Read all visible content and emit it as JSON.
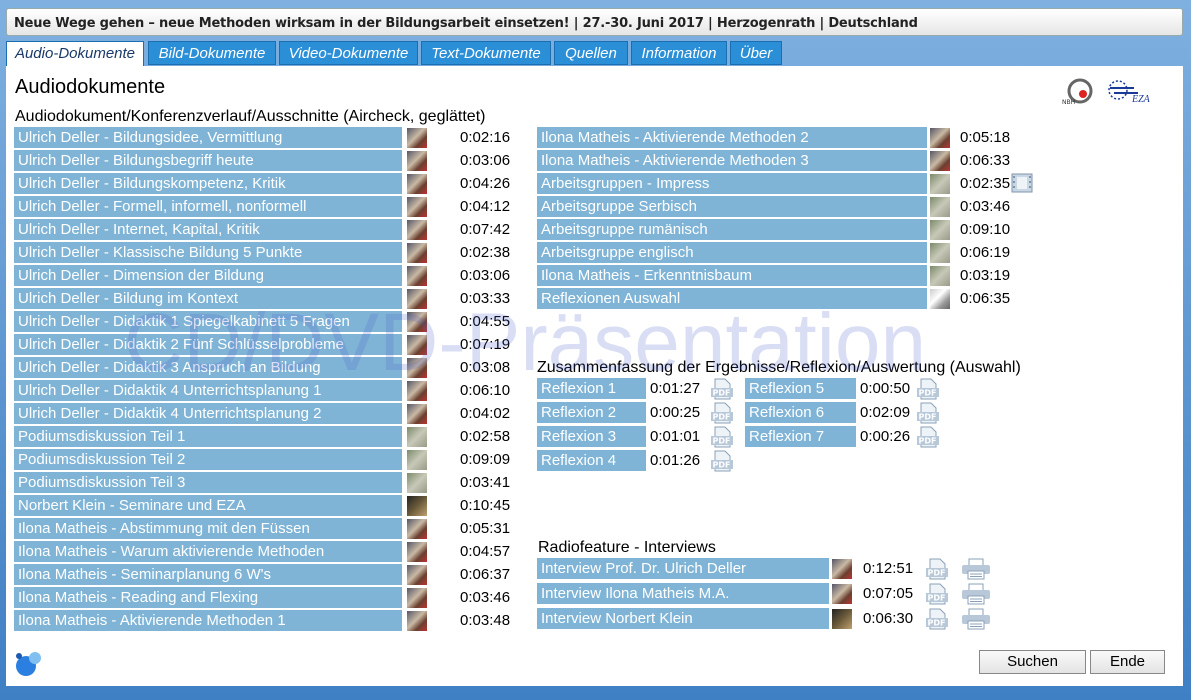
{
  "window": {
    "title": "Neue Wege gehen – neue Methoden wirksam in der Bildungsarbeit einsetzen! | 27.-30. Juni 2017 | Herzogenrath | Deutschland"
  },
  "tabs": [
    "Audio-Dokumente",
    "Bild-Dokumente",
    "Video-Dokumente",
    "Text-Dokumente",
    "Quellen",
    "Information",
    "Über"
  ],
  "page_title": "Audiodokumente",
  "watermark": "CD/DVD-Präsentation",
  "left_section": {
    "heading": "Audiodokument/Konferenzverlauf/Ausschnitte (Aircheck, geglättet)",
    "items": [
      {
        "label": "Ulrich Deller - Bildungsidee, Vermittlung",
        "duration": "0:02:16"
      },
      {
        "label": "Ulrich Deller - Bildungsbegriff heute",
        "duration": "0:03:06"
      },
      {
        "label": "Ulrich Deller - Bildungskompetenz, Kritik",
        "duration": "0:04:26"
      },
      {
        "label": "Ulrich Deller - Formell, informell, nonformell",
        "duration": "0:04:12"
      },
      {
        "label": "Ulrich Deller - Internet, Kapital, Kritik",
        "duration": "0:07:42"
      },
      {
        "label": "Ulrich Deller - Klassische Bildung 5 Punkte",
        "duration": "0:02:38"
      },
      {
        "label": "Ulrich Deller - Dimension der Bildung",
        "duration": "0:03:06"
      },
      {
        "label": "Ulrich Deller - Bildung im Kontext",
        "duration": "0:03:33"
      },
      {
        "label": "Ulrich Deller - Didaktik 1 Spiegelkabinett 5 Fragen",
        "duration": "0:04:55"
      },
      {
        "label": "Ulrich Deller - Didaktik 2 Fünf Schlüsselprobleme",
        "duration": "0:07:19"
      },
      {
        "label": "Ulrich Deller - Didaktik 3 Anspruch an Bildung",
        "duration": "0:03:08"
      },
      {
        "label": "Ulrich Deller - Didaktik 4 Unterrichtsplanung 1",
        "duration": "0:06:10"
      },
      {
        "label": "Ulrich Deller - Didaktik 4 Unterrichtsplanung 2",
        "duration": "0:04:02"
      },
      {
        "label": "Podiumsdiskussion Teil 1",
        "duration": "0:02:58"
      },
      {
        "label": "Podiumsdiskussion Teil 2",
        "duration": "0:09:09"
      },
      {
        "label": "Podiumsdiskussion Teil 3",
        "duration": "0:03:41"
      },
      {
        "label": "Norbert Klein - Seminare und EZA",
        "duration": "0:10:45"
      },
      {
        "label": "Ilona Matheis - Abstimmung mit den Füssen",
        "duration": "0:05:31"
      },
      {
        "label": "Ilona Matheis - Warum aktivierende Methoden",
        "duration": "0:04:57"
      },
      {
        "label": "Ilona Matheis - Seminarplanung 6 W's",
        "duration": "0:06:37"
      },
      {
        "label": "Ilona Matheis -  Reading and Flexing",
        "duration": "0:03:46"
      },
      {
        "label": "Ilona Matheis - Aktivierende Methoden 1",
        "duration": "0:03:48"
      }
    ]
  },
  "right_items": [
    {
      "label": "Ilona Matheis - Aktivierende Methoden 2",
      "duration": "0:05:18"
    },
    {
      "label": "Ilona Matheis - Aktivierende Methoden 3",
      "duration": "0:06:33"
    },
    {
      "label": "Arbeitsgruppen - Impress",
      "duration": "0:02:35"
    },
    {
      "label": "Arbeitsgruppe Serbisch",
      "duration": "0:03:46"
    },
    {
      "label": "Arbeitsgruppe rumänisch",
      "duration": "0:09:10"
    },
    {
      "label": "Arbeitsgruppe englisch",
      "duration": "0:06:19"
    },
    {
      "label": "Ilona Matheis - Erkenntnisbaum",
      "duration": "0:03:19"
    },
    {
      "label": "Reflexionen Auswahl",
      "duration": "0:06:35"
    }
  ],
  "summary_section": {
    "heading": "Zusammenfassung der Ergebnisse/Reflexion/Auswertung (Auswahl)",
    "items": [
      {
        "label": "Reflexion 1",
        "duration": "0:01:27"
      },
      {
        "label": "Reflexion 2",
        "duration": "0:00:25"
      },
      {
        "label": "Reflexion 3",
        "duration": "0:01:01"
      },
      {
        "label": "Reflexion 4",
        "duration": "0:01:26"
      },
      {
        "label": "Reflexion 5",
        "duration": "0:00:50"
      },
      {
        "label": "Reflexion 6",
        "duration": "0:02:09"
      },
      {
        "label": "Reflexion 7",
        "duration": "0:00:26"
      }
    ]
  },
  "radio_section": {
    "heading": "Radiofeature - Interviews",
    "items": [
      {
        "label": "Interview Prof. Dr. Ulrich Deller",
        "duration": "0:12:51"
      },
      {
        "label": "Interview Ilona Matheis M.A.",
        "duration": "0:07:05"
      },
      {
        "label": "Interview Norbert Klein",
        "duration": "0:06:30"
      }
    ]
  },
  "logos": {
    "nbh": "NBH",
    "eza": "EZA"
  },
  "icons": {
    "pdf": "pdf-icon",
    "print": "printer-icon",
    "film": "film-icon"
  },
  "buttons": {
    "search": "Suchen",
    "end": "Ende"
  },
  "colors": {
    "item_bg": "#7fb4d6",
    "tab_bg": "#2b8fd8",
    "frame": "#3f7fc4"
  }
}
